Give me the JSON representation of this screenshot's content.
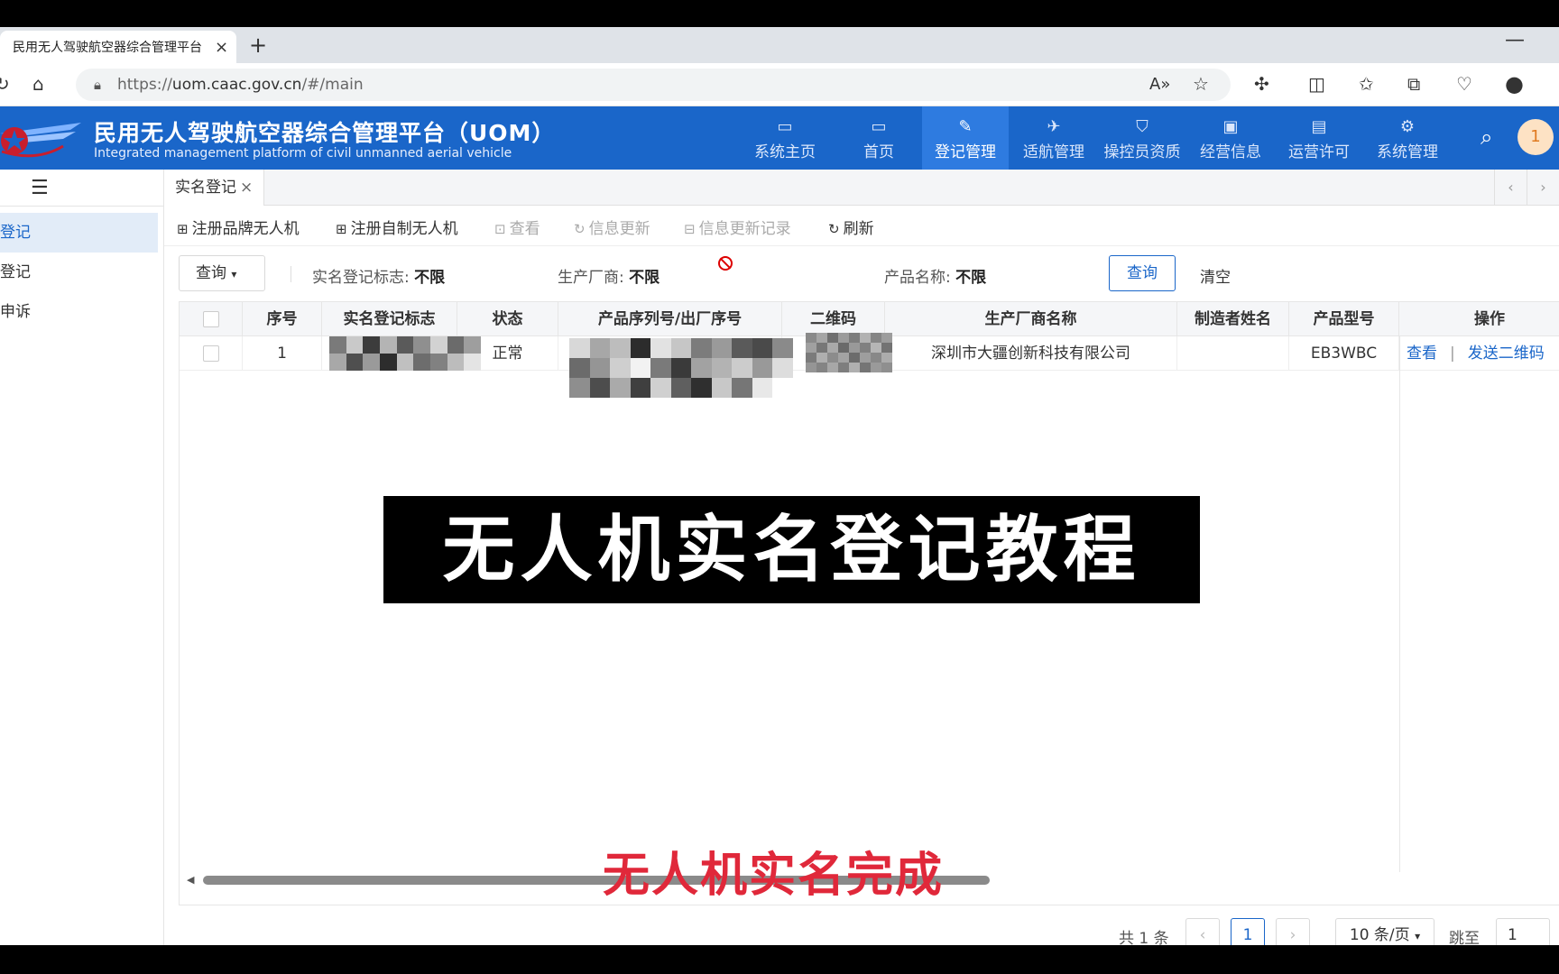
{
  "browser": {
    "tab_title": "民用无人驾驶航空器综合管理平台",
    "tab_close": "×",
    "new_tab": "+",
    "url_prefix": "https://",
    "url_host": "uom.caac.gov.cn",
    "url_path": "/#/main"
  },
  "app": {
    "title": "民用无人驾驶航空器综合管理平台（UOM）",
    "subtitle": "Integrated management platform of civil unmanned aerial vehicle",
    "nav": [
      {
        "label": "系统主页",
        "icon": "dashboard-icon"
      },
      {
        "label": "首页",
        "icon": "monitor-icon"
      },
      {
        "label": "登记管理",
        "icon": "registration-icon",
        "active": true
      },
      {
        "label": "适航管理",
        "icon": "drone-icon"
      },
      {
        "label": "操控员资质",
        "icon": "shield-icon"
      },
      {
        "label": "经营信息",
        "icon": "id-card-icon"
      },
      {
        "label": "运营许可",
        "icon": "permit-icon"
      },
      {
        "label": "系统管理",
        "icon": "settings-icon"
      }
    ],
    "avatar_text": "1"
  },
  "sidebar": {
    "items": [
      {
        "label": "登记",
        "active": true
      },
      {
        "label": "登记"
      },
      {
        "label": "申诉"
      }
    ]
  },
  "tabs": {
    "current": "实名登记",
    "close": "×"
  },
  "actions": [
    {
      "label": "注册品牌无人机",
      "disabled": false
    },
    {
      "label": "注册自制无人机",
      "disabled": false
    },
    {
      "label": "查看",
      "disabled": true
    },
    {
      "label": "信息更新",
      "disabled": true
    },
    {
      "label": "信息更新记录",
      "disabled": true
    },
    {
      "label": "刷新",
      "disabled": false
    }
  ],
  "filters": {
    "query_dropdown": "查询",
    "reg_mark_label": "实名登记标志:",
    "reg_mark_value": "不限",
    "manufacturer_label": "生产厂商:",
    "manufacturer_value": "不限",
    "product_label": "产品名称:",
    "product_value": "不限",
    "query_button": "查询",
    "clear_button": "清空"
  },
  "table": {
    "columns": [
      "序号",
      "实名登记标志",
      "状态",
      "产品序列号/出厂序号",
      "二维码",
      "生产厂商名称",
      "制造者姓名",
      "产品型号",
      "操作"
    ],
    "rows": [
      {
        "index": "1",
        "status": "正常",
        "manufacturer": "深圳市大疆创新科技有限公司",
        "maker_name": "",
        "model": "EB3WBC",
        "op_view": "查看",
        "op_send": "发送二维码"
      }
    ]
  },
  "pagination": {
    "total": "共 1 条",
    "current_page": "1",
    "page_size": "10 条/页",
    "jump_label": "跳至",
    "jump_value": "1"
  },
  "overlay": {
    "banner": "无人机实名登记教程",
    "caption": "无人机实名完成"
  },
  "colors": {
    "brand_blue": "#1a66c9",
    "caption_red": "#e0283a"
  }
}
